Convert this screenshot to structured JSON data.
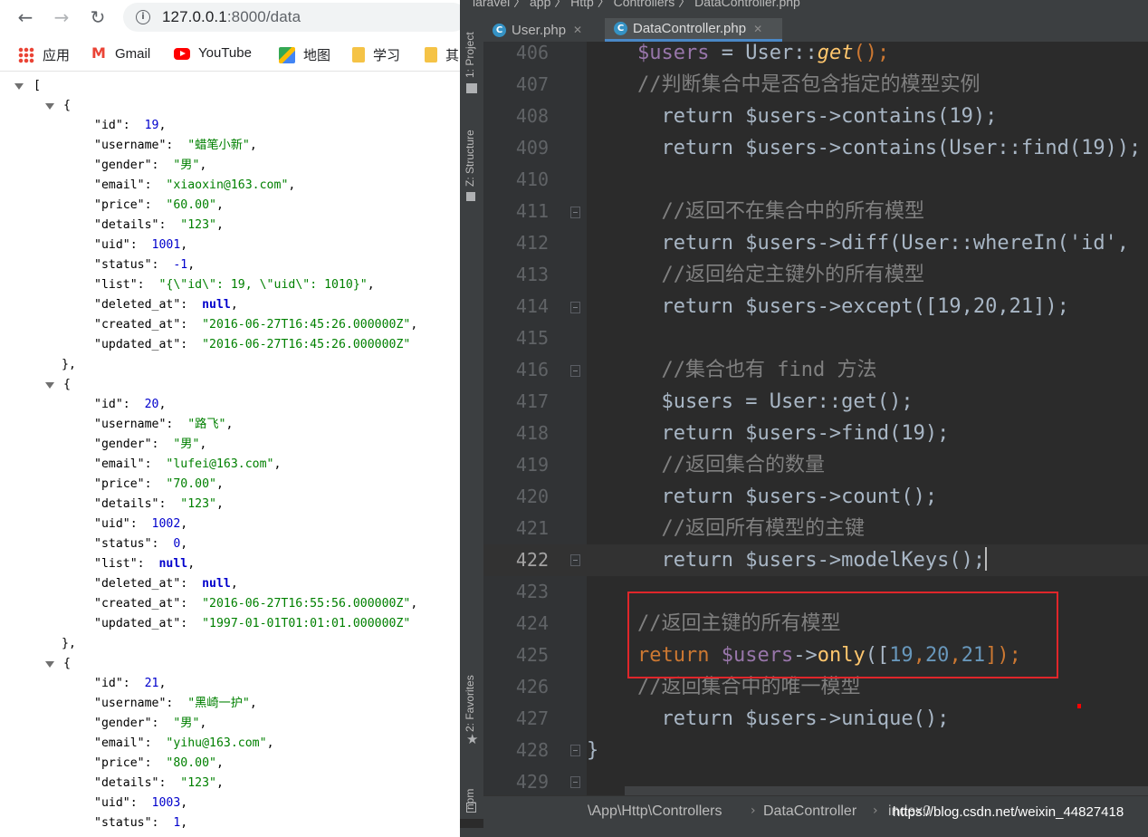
{
  "browser": {
    "url_host": "127.0.0.1",
    "url_path": ":8000/data",
    "bookmarks": [
      {
        "label": "应用",
        "icon": "apps-grid-icon"
      },
      {
        "label": "Gmail",
        "icon": "gmail-icon"
      },
      {
        "label": "YouTube",
        "icon": "youtube-icon"
      },
      {
        "label": "地图",
        "icon": "maps-icon"
      },
      {
        "label": "学习",
        "icon": "folder-icon"
      },
      {
        "label": "其",
        "icon": "folder-icon"
      }
    ],
    "json_open": "[",
    "records": [
      {
        "id": "19",
        "username": "\"蜡笔小新\"",
        "gender": "\"男\"",
        "email": "\"xiaoxin@163.com\"",
        "price": "\"60.00\"",
        "details": "\"123\"",
        "uid": "1001",
        "status": "-1",
        "list": "\"{\\\"id\\\": 19, \\\"uid\\\": 1010}\"",
        "deleted_at": "null",
        "created_at": "\"2016-06-27T16:45:26.000000Z\"",
        "updated_at": "\"2016-06-27T16:45:26.000000Z\""
      },
      {
        "id": "20",
        "username": "\"路飞\"",
        "gender": "\"男\"",
        "email": "\"lufei@163.com\"",
        "price": "\"70.00\"",
        "details": "\"123\"",
        "uid": "1002",
        "status": "0",
        "list": "null",
        "deleted_at": "null",
        "created_at": "\"2016-06-27T16:55:56.000000Z\"",
        "updated_at": "\"1997-01-01T01:01:01.000000Z\""
      },
      {
        "id": "21",
        "username": "\"黑崎一护\"",
        "gender": "\"男\"",
        "email": "\"yihu@163.com\"",
        "price": "\"80.00\"",
        "details": "\"123\"",
        "uid": "1003",
        "status": "1"
      }
    ]
  },
  "ide": {
    "top_breadcrumb": "laravel 〉 app 〉 Http 〉 Controllers 〉 DataController.php",
    "tabs": [
      {
        "label": "User.php",
        "active": false
      },
      {
        "label": "DataController.php",
        "active": true
      }
    ],
    "side_tools": {
      "project": "1: Project",
      "structure": "Z: Structure",
      "favorites": "2: Favorites",
      "npm": "npm"
    },
    "line_numbers": [
      "406",
      "407",
      "408",
      "409",
      "410",
      "411",
      "412",
      "413",
      "414",
      "415",
      "416",
      "417",
      "418",
      "419",
      "420",
      "421",
      "422",
      "423",
      "424",
      "425",
      "426",
      "427",
      "428",
      "429"
    ],
    "current_line": "422",
    "code": {
      "l406_var": "$users",
      "l406_rest": " = User::",
      "l406_fn": "get",
      "l406_end": "();",
      "l407": "//判断集合中是否包含指定的模型实例",
      "l408": "  return $users->contains(19);",
      "l409": "  return $users->contains(User::find(19));",
      "l410": "",
      "l411": "  //返回不在集合中的所有模型",
      "l412": "  return $users->diff(User::whereIn('id',",
      "l413": "  //返回给定主键外的所有模型",
      "l414": "  return $users->except([19,20,21]);",
      "l415": "",
      "l416": "  //集合也有 find 方法",
      "l417": "  $users = User::get();",
      "l418": "  return $users->find(19);",
      "l419": "  //返回集合的数量",
      "l420": "  return $users->count();",
      "l421": "  //返回所有模型的主键",
      "l422": "  return $users->modelKeys();",
      "l423": "",
      "l424": "//返回主键的所有模型",
      "l425_kw": "return",
      "l425_var": " $users",
      "l425_arrow": "->",
      "l425_fn": "only",
      "l425_open": "([",
      "l425_n1": "19",
      "l425_n2": "20",
      "l425_n3": "21",
      "l425_close": "]);",
      "l426": "//返回集合中的唯一模型",
      "l427": "  return $users->unique();",
      "l428": "}",
      "l429": ""
    },
    "status_breadcrumb": [
      "\\App\\Http\\Controllers",
      "DataController",
      "index0"
    ],
    "watermark": "https://blog.csdn.net/weixin_44827418"
  }
}
